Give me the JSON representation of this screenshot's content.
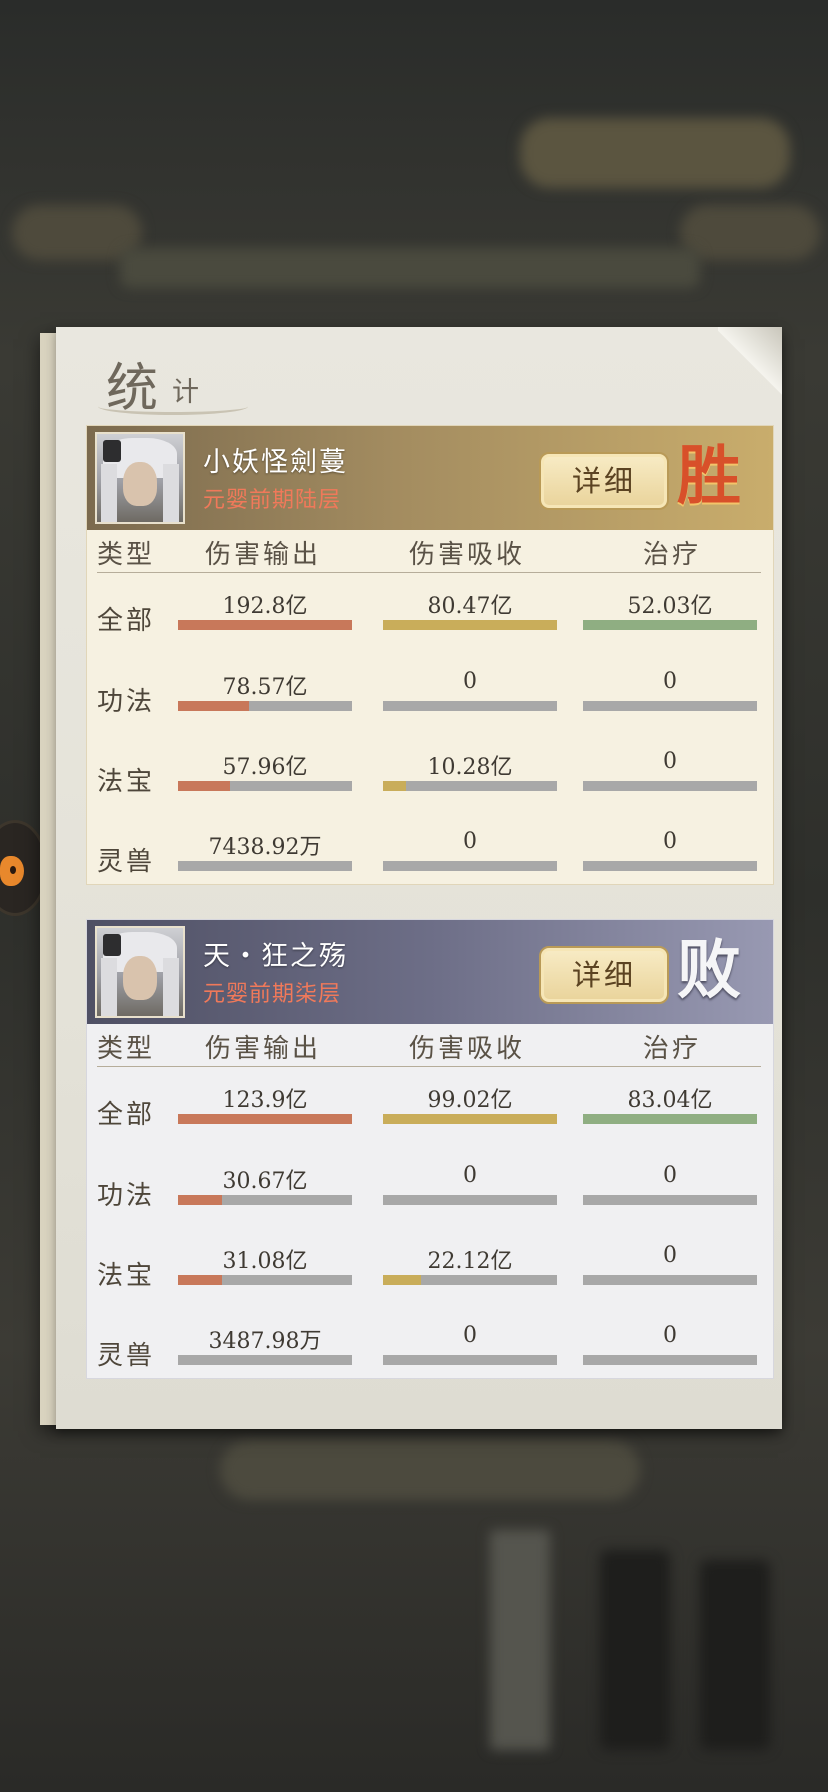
{
  "title": {
    "big": "统",
    "small": "计"
  },
  "columns": [
    "类型",
    "伤害输出",
    "伤害吸收",
    "治疗"
  ],
  "detail_label": "详细",
  "players": [
    {
      "name": "小妖怪劍蔓",
      "rank": "元婴前期陆层",
      "result": "胜",
      "rows": [
        {
          "label": "全部",
          "cells": [
            {
              "text": "192.8亿",
              "fill": 1.0
            },
            {
              "text": "80.47亿",
              "fill": 1.0
            },
            {
              "text": "52.03亿",
              "fill": 1.0
            }
          ]
        },
        {
          "label": "功法",
          "cells": [
            {
              "text": "78.57亿",
              "fill": 0.41
            },
            {
              "text": "0",
              "fill": 0
            },
            {
              "text": "0",
              "fill": 0
            }
          ]
        },
        {
          "label": "法宝",
          "cells": [
            {
              "text": "57.96亿",
              "fill": 0.3
            },
            {
              "text": "10.28亿",
              "fill": 0.13
            },
            {
              "text": "0",
              "fill": 0
            }
          ]
        },
        {
          "label": "灵兽",
          "cells": [
            {
              "text": "7438.92万",
              "fill": 0.0
            },
            {
              "text": "0",
              "fill": 0
            },
            {
              "text": "0",
              "fill": 0
            }
          ]
        }
      ]
    },
    {
      "name": "天・狂之殇",
      "rank": "元婴前期柒层",
      "result": "败",
      "rows": [
        {
          "label": "全部",
          "cells": [
            {
              "text": "123.9亿",
              "fill": 1.0
            },
            {
              "text": "99.02亿",
              "fill": 1.0
            },
            {
              "text": "83.04亿",
              "fill": 1.0
            }
          ]
        },
        {
          "label": "功法",
          "cells": [
            {
              "text": "30.67亿",
              "fill": 0.25
            },
            {
              "text": "0",
              "fill": 0
            },
            {
              "text": "0",
              "fill": 0
            }
          ]
        },
        {
          "label": "法宝",
          "cells": [
            {
              "text": "31.08亿",
              "fill": 0.25
            },
            {
              "text": "22.12亿",
              "fill": 0.22
            },
            {
              "text": "0",
              "fill": 0
            }
          ]
        },
        {
          "label": "灵兽",
          "cells": [
            {
              "text": "3487.98万",
              "fill": 0.0
            },
            {
              "text": "0",
              "fill": 0
            },
            {
              "text": "0",
              "fill": 0
            }
          ]
        }
      ]
    }
  ],
  "colors": {
    "damage": "#c8785a",
    "absorb": "#c9ad5a",
    "heal": "#8fae82",
    "empty": "#a8a8a8",
    "win": "#d8502a",
    "rank": "#f0795a"
  }
}
